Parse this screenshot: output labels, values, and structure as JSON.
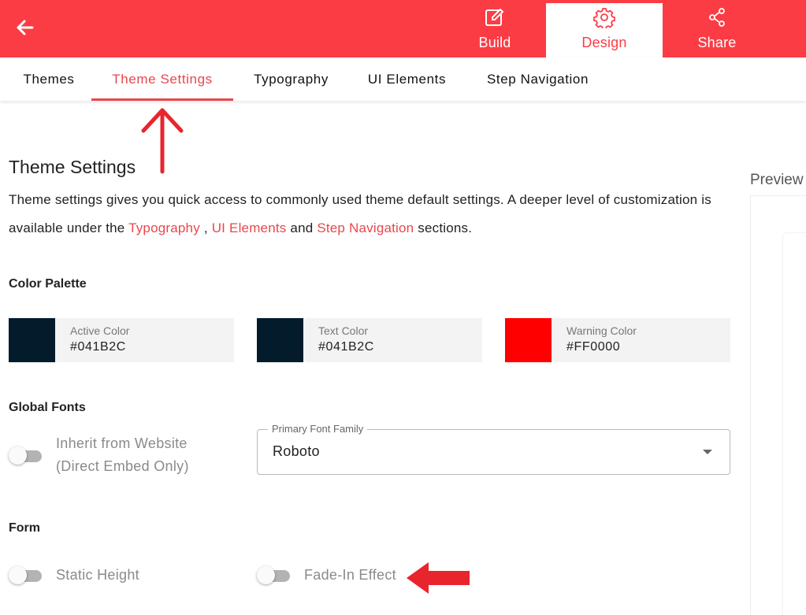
{
  "header": {
    "tabs": [
      {
        "id": "build",
        "label": "Build",
        "icon": "edit-icon"
      },
      {
        "id": "design",
        "label": "Design",
        "icon": "gear-icon",
        "active": true
      },
      {
        "id": "share",
        "label": "Share",
        "icon": "share-icon"
      }
    ],
    "accent_color": "#fc3c44"
  },
  "subnav": {
    "items": [
      "Themes",
      "Theme Settings",
      "Typography",
      "UI Elements",
      "Step Navigation"
    ],
    "active": "Theme Settings"
  },
  "main": {
    "title": "Theme Settings",
    "description": {
      "before": "Theme settings gives you quick access to commonly used theme default settings. A deeper level of customization is available under the ",
      "link1": "Typography",
      "sep1": " , ",
      "link2": "UI Elements",
      "sep2": " and ",
      "link3": "Step Navigation",
      "after": " sections."
    },
    "color_palette": {
      "heading": "Color Palette",
      "colors": [
        {
          "label": "Active Color",
          "value": "#041B2C",
          "swatch": "#041b2c"
        },
        {
          "label": "Text Color",
          "value": "#041B2C",
          "swatch": "#041b2c"
        },
        {
          "label": "Warning Color",
          "value": "#FF0000",
          "swatch": "#ff0000"
        }
      ]
    },
    "global_fonts": {
      "heading": "Global Fonts",
      "inherit_toggle_label_line1": "Inherit from Website",
      "inherit_toggle_label_line2": "(Direct Embed Only)",
      "inherit_enabled": false,
      "font_select_label": "Primary Font Family",
      "font_select_value": "Roboto"
    },
    "form": {
      "heading": "Form",
      "static_height_label": "Static Height",
      "static_height_enabled": false,
      "fade_in_label": "Fade-In Effect",
      "fade_in_enabled": false
    }
  },
  "preview": {
    "label": "Preview"
  }
}
